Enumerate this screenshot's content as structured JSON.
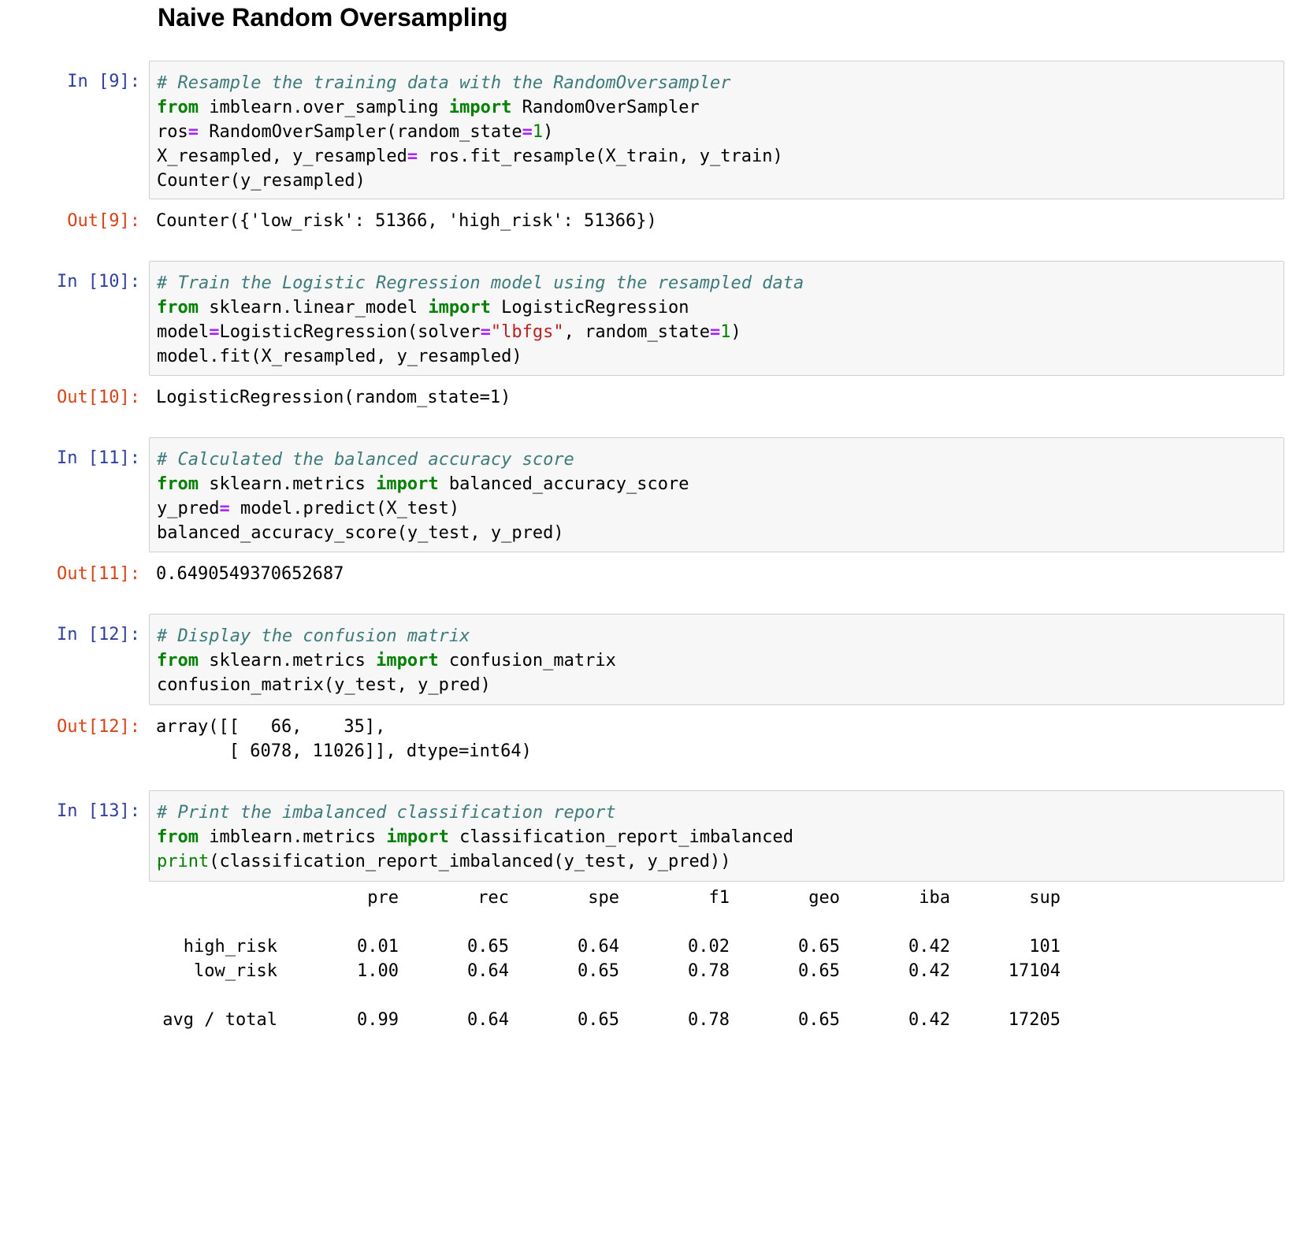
{
  "heading": "Naive Random Oversampling",
  "cells": [
    {
      "in_prompt": "In [9]:",
      "out_prompt": "Out[9]:",
      "code": [
        [
          {
            "t": "# Resample the training data with the RandomOversampler",
            "c": "comment"
          }
        ],
        [
          {
            "t": "from",
            "c": "kw"
          },
          {
            "t": " imblearn.over_sampling ",
            "c": ""
          },
          {
            "t": "import",
            "c": "kw"
          },
          {
            "t": " RandomOverSampler",
            "c": ""
          }
        ],
        [
          {
            "t": "ros",
            "c": ""
          },
          {
            "t": "=",
            "c": "op"
          },
          {
            "t": " RandomOverSampler(random_state",
            "c": ""
          },
          {
            "t": "=",
            "c": "op"
          },
          {
            "t": "1",
            "c": "num"
          },
          {
            "t": ")",
            "c": ""
          }
        ],
        [
          {
            "t": "X_resampled, y_resampled",
            "c": ""
          },
          {
            "t": "=",
            "c": "op"
          },
          {
            "t": " ros.fit_resample(X_train, y_train)",
            "c": ""
          }
        ],
        [
          {
            "t": "Counter(y_resampled)",
            "c": ""
          }
        ]
      ],
      "output": "Counter({'low_risk': 51366, 'high_risk': 51366})"
    },
    {
      "in_prompt": "In [10]:",
      "out_prompt": "Out[10]:",
      "code": [
        [
          {
            "t": "# Train the Logistic Regression model using the resampled data",
            "c": "comment"
          }
        ],
        [
          {
            "t": "from",
            "c": "kw"
          },
          {
            "t": " sklearn.linear_model ",
            "c": ""
          },
          {
            "t": "import",
            "c": "kw"
          },
          {
            "t": " LogisticRegression",
            "c": ""
          }
        ],
        [
          {
            "t": "model",
            "c": ""
          },
          {
            "t": "=",
            "c": "op"
          },
          {
            "t": "LogisticRegression(solver",
            "c": ""
          },
          {
            "t": "=",
            "c": "op"
          },
          {
            "t": "\"lbfgs\"",
            "c": "str"
          },
          {
            "t": ", random_state",
            "c": ""
          },
          {
            "t": "=",
            "c": "op"
          },
          {
            "t": "1",
            "c": "num"
          },
          {
            "t": ")",
            "c": ""
          }
        ],
        [
          {
            "t": "model.fit(X_resampled, y_resampled)",
            "c": ""
          }
        ]
      ],
      "output": "LogisticRegression(random_state=1)"
    },
    {
      "in_prompt": "In [11]:",
      "out_prompt": "Out[11]:",
      "code": [
        [
          {
            "t": "# Calculated the balanced accuracy score",
            "c": "comment"
          }
        ],
        [
          {
            "t": "from",
            "c": "kw"
          },
          {
            "t": " sklearn.metrics ",
            "c": ""
          },
          {
            "t": "import",
            "c": "kw"
          },
          {
            "t": " balanced_accuracy_score",
            "c": ""
          }
        ],
        [
          {
            "t": "y_pred",
            "c": ""
          },
          {
            "t": "=",
            "c": "op"
          },
          {
            "t": " model.predict(X_test)",
            "c": ""
          }
        ],
        [
          {
            "t": "balanced_accuracy_score(y_test, y_pred)",
            "c": ""
          }
        ]
      ],
      "output": "0.6490549370652687"
    },
    {
      "in_prompt": "In [12]:",
      "out_prompt": "Out[12]:",
      "code": [
        [
          {
            "t": "# Display the confusion matrix",
            "c": "comment"
          }
        ],
        [
          {
            "t": "from",
            "c": "kw"
          },
          {
            "t": " sklearn.metrics ",
            "c": ""
          },
          {
            "t": "import",
            "c": "kw"
          },
          {
            "t": " confusion_matrix",
            "c": ""
          }
        ],
        [
          {
            "t": "confusion_matrix(y_test, y_pred)",
            "c": ""
          }
        ]
      ],
      "output": "array([[   66,    35],\n       [ 6078, 11026]], dtype=int64)"
    },
    {
      "in_prompt": "In [13]:",
      "out_prompt": "",
      "code": [
        [
          {
            "t": "# Print the imbalanced classification report",
            "c": "comment"
          }
        ],
        [
          {
            "t": "from",
            "c": "kw"
          },
          {
            "t": " imblearn.metrics ",
            "c": ""
          },
          {
            "t": "import",
            "c": "kw"
          },
          {
            "t": " classification_report_imbalanced",
            "c": ""
          }
        ],
        [
          {
            "t": "print",
            "c": "builtin"
          },
          {
            "t": "(classification_report_imbalanced(y_test, y_pred))",
            "c": ""
          }
        ]
      ],
      "output": ""
    }
  ],
  "report": {
    "headers": [
      "pre",
      "rec",
      "spe",
      "f1",
      "geo",
      "iba",
      "sup"
    ],
    "rows": [
      {
        "label": "high_risk",
        "values": [
          "0.01",
          "0.65",
          "0.64",
          "0.02",
          "0.65",
          "0.42",
          "101"
        ]
      },
      {
        "label": "low_risk",
        "values": [
          "1.00",
          "0.64",
          "0.65",
          "0.78",
          "0.65",
          "0.42",
          "17104"
        ]
      }
    ],
    "total": {
      "label": "avg / total",
      "values": [
        "0.99",
        "0.64",
        "0.65",
        "0.78",
        "0.65",
        "0.42",
        "17205"
      ]
    }
  }
}
